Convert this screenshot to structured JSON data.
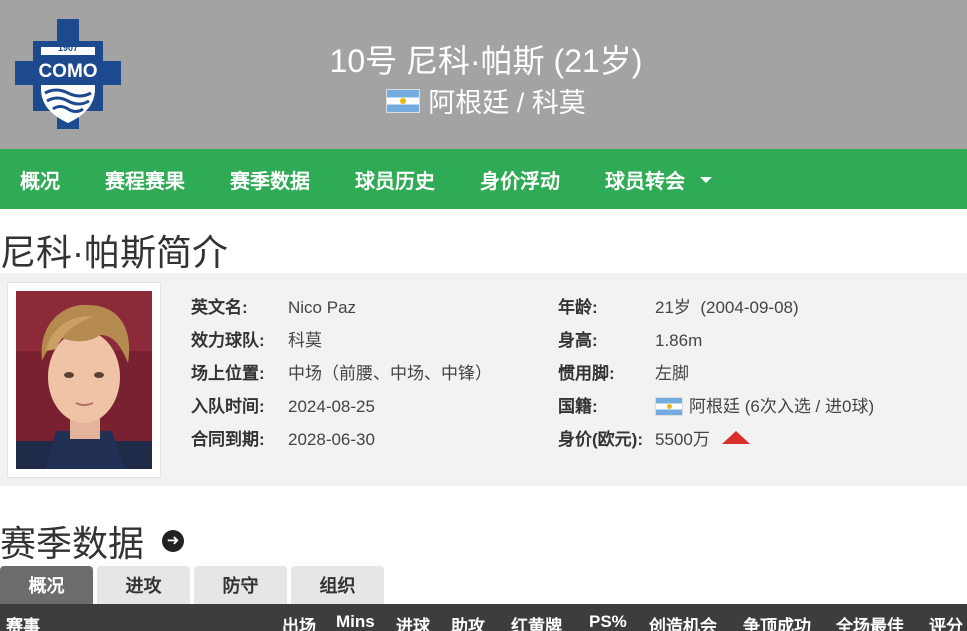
{
  "header": {
    "club_logo": {
      "icon": "como-club-crest",
      "year_text": "1907",
      "name_text": "COMO"
    },
    "title": "10号 尼科·帕斯 (21岁)",
    "nationality_flag": "argentina-flag-icon",
    "subtitle": "阿根廷 / 科莫",
    "colors": {
      "header_bg": "#a3a3a3",
      "crest_blue": "#1d4a8e"
    }
  },
  "nav": {
    "items": [
      {
        "label": "概况"
      },
      {
        "label": "赛程赛果"
      },
      {
        "label": "赛季数据"
      },
      {
        "label": "球员历史"
      },
      {
        "label": "身价浮动"
      },
      {
        "label": "球员转会"
      }
    ],
    "more_icon": "chevron-down-icon",
    "color": "#2faa55"
  },
  "intro": {
    "title": "尼科·帕斯简介",
    "left": [
      {
        "label": "英文名:",
        "value": "Nico Paz"
      },
      {
        "label": "效力球队:",
        "value": "科莫"
      },
      {
        "label": "场上位置:",
        "value": "中场（前腰、中场、中锋）"
      },
      {
        "label": "入队时间:",
        "value": "2024-08-25"
      },
      {
        "label": "合同到期:",
        "value": "2028-06-30"
      }
    ],
    "right": [
      {
        "label": "年龄:",
        "value": "21岁  (2004-09-08)"
      },
      {
        "label": "身高:",
        "value": "1.86m"
      },
      {
        "label": "惯用脚:",
        "value": "左脚"
      },
      {
        "label": "国籍:",
        "value": "阿根廷 (6次入选 / 进0球)"
      },
      {
        "label": "身价(欧元):",
        "value": "5500万"
      }
    ],
    "value_trend_icon": "up-arrow-icon",
    "trend_color": "#d9302e"
  },
  "season": {
    "title": "赛季数据",
    "title_icon": "arrow-circle-right-icon",
    "tabs": [
      {
        "label": "概况",
        "active": true
      },
      {
        "label": "进攻",
        "active": false
      },
      {
        "label": "防守",
        "active": false
      },
      {
        "label": "组织",
        "active": false
      }
    ],
    "columns": [
      "赛事",
      "出场",
      "Mins",
      "进球",
      "助攻",
      "红黄牌",
      "PS%",
      "创造机会",
      "争顶成功",
      "全场最佳",
      "评分"
    ]
  }
}
